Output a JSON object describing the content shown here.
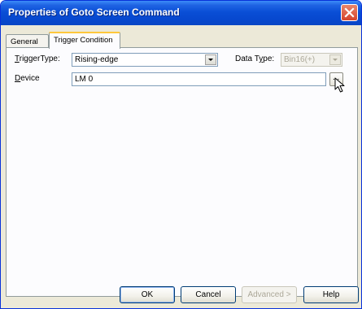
{
  "window": {
    "title": "Properties of Goto Screen Command"
  },
  "tabs": [
    {
      "label": "General"
    },
    {
      "label": "Trigger Condition",
      "selected": true
    }
  ],
  "trigger_type": {
    "label_mnemonic": "T",
    "label_rest": "riggerType:",
    "value": "Rising-edge"
  },
  "data_type": {
    "label_pre": "Data T",
    "label_mnemonic": "y",
    "label_post": "pe:",
    "value": "Bin16(+)",
    "enabled": false
  },
  "device": {
    "label_mnemonic": "D",
    "label_rest": "evice",
    "value": "LM 0",
    "browse_label": "..."
  },
  "buttons": {
    "ok": "OK",
    "cancel": "Cancel",
    "advanced": "Advanced >",
    "help": "Help"
  },
  "colors": {
    "title_bar": "#0a4fd6",
    "dialog_face": "#ece9d8",
    "close_button": "#d5442c"
  },
  "icons": {
    "close": "close-icon",
    "dropdown": "chevron-down-icon",
    "pointer": "mouse-pointer-icon"
  }
}
